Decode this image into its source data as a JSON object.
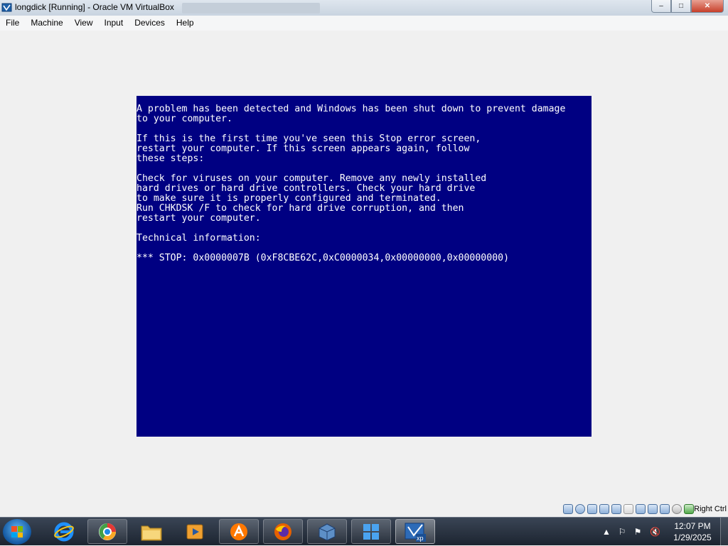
{
  "window": {
    "title": "longdick [Running] - Oracle VM VirtualBox",
    "buttons": {
      "minimize": "–",
      "maximize": "□",
      "close": "✕"
    }
  },
  "menu": [
    "File",
    "Machine",
    "View",
    "Input",
    "Devices",
    "Help"
  ],
  "bsod": {
    "background": "#000082",
    "text": "A problem has been detected and Windows has been shut down to prevent damage\nto your computer.\n\nIf this is the first time you've seen this Stop error screen,\nrestart your computer. If this screen appears again, follow\nthese steps:\n\nCheck for viruses on your computer. Remove any newly installed\nhard drives or hard drive controllers. Check your hard drive\nto make sure it is properly configured and terminated.\nRun CHKDSK /F to check for hard drive corruption, and then\nrestart your computer.\n\nTechnical information:\n\n*** STOP: 0x0000007B (0xF8CBE62C,0xC0000034,0x00000000,0x00000000)"
  },
  "statusbar": {
    "icons": [
      "hard-disk-icon",
      "optical-drive-icon",
      "audio-icon",
      "network-icon",
      "usb-icon",
      "shared-folders-icon",
      "display-icon",
      "recording-icon",
      "virtualization-icon",
      "mouse-integration-icon",
      "keyboard-icon"
    ],
    "host_key": "Right Ctrl"
  },
  "taskbar": {
    "start": "start-button",
    "apps": [
      {
        "name": "internet-explorer",
        "style": "plain"
      },
      {
        "name": "chromium-browser",
        "style": "pinned"
      },
      {
        "name": "file-explorer",
        "style": "plain"
      },
      {
        "name": "media-player",
        "style": "plain"
      },
      {
        "name": "avast",
        "style": "pinned"
      },
      {
        "name": "firefox",
        "style": "pinned"
      },
      {
        "name": "virtualbox",
        "style": "pinned"
      },
      {
        "name": "windows",
        "style": "pinned"
      },
      {
        "name": "virtualbox-xp-vm",
        "style": "active"
      }
    ],
    "clock": {
      "time": "12:07 PM",
      "date": "1/29/2025"
    }
  },
  "colors": {
    "titlebar": "#c9d4e0",
    "taskbar": "#1c2430",
    "bsod_text": "#ffffff"
  }
}
